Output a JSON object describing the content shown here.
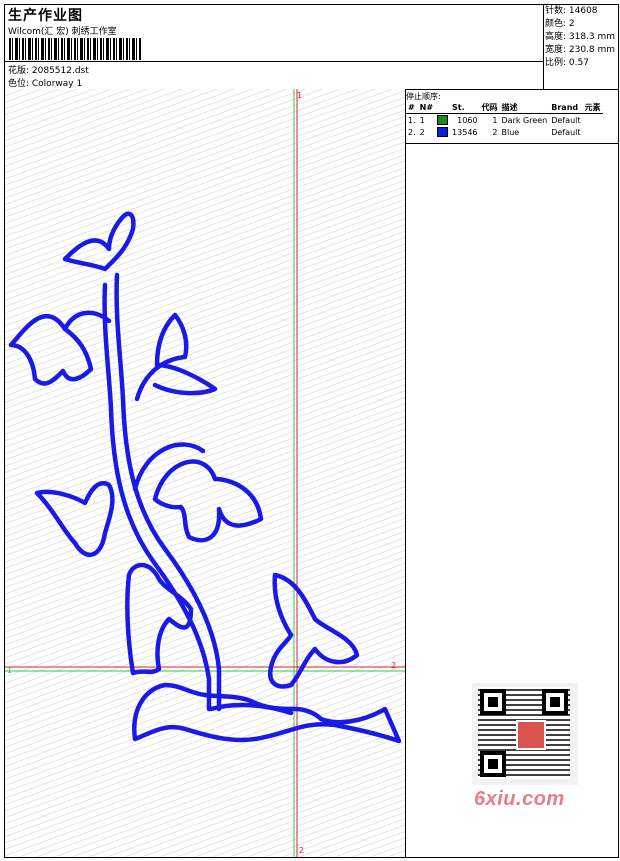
{
  "header": {
    "title": "生产作业图",
    "company": "Wilcom(汇 宏) 刺绣工作室",
    "design_line": "花版: 2085512.dst",
    "colorway_line": "色位: Colorway 1"
  },
  "stats": {
    "stitches": "针数: 14608",
    "colors": "颜色: 2",
    "height": "高度: 318.3 mm",
    "width": "宽度: 230.8 mm",
    "scale": "比例: 0.57"
  },
  "stop_sequence": {
    "title": "停止顺序:",
    "headers": [
      "#",
      "N#",
      "St.",
      "代码",
      "描述",
      "Brand",
      "元素"
    ],
    "rows": [
      {
        "idx": "1.",
        "n": "1",
        "color": "#1a8a1a",
        "stitches": "1060",
        "code": "1",
        "desc": "Dark Green",
        "brand": "Default",
        "element": ""
      },
      {
        "idx": "2.",
        "n": "2",
        "color": "#0a20e0",
        "stitches": "13546",
        "code": "2",
        "desc": "Blue",
        "brand": "Default",
        "element": ""
      }
    ]
  },
  "guides": {
    "v_top": "1",
    "v_bottom": "2",
    "h_left": "1",
    "h_right": "2"
  },
  "colors": {
    "embroidery_blue": "#1a1ae6",
    "guide_green": "#2ecc40",
    "guide_red": "#e0203a"
  },
  "watermark": "6xiu.com"
}
